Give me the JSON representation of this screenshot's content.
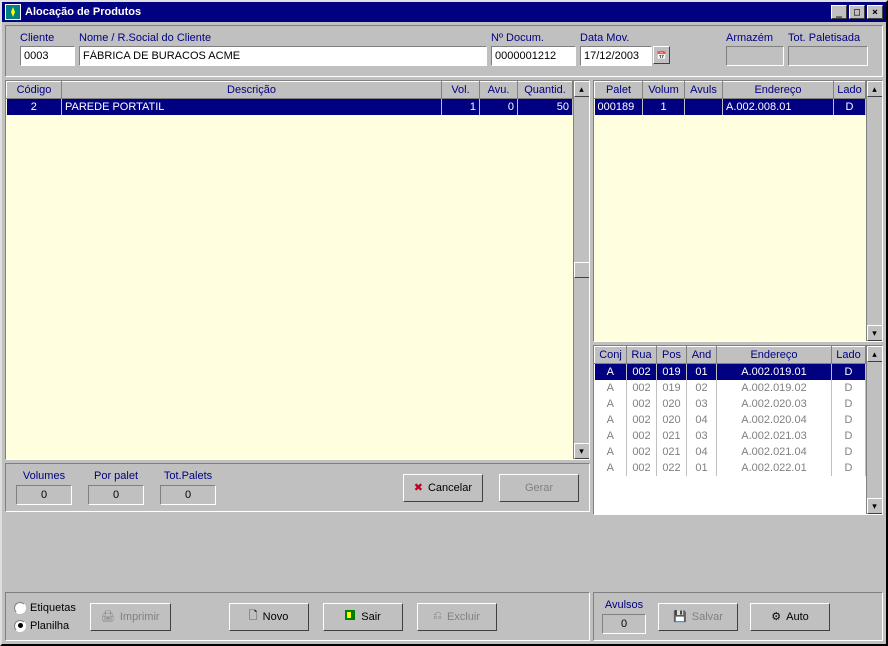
{
  "window": {
    "title": "Alocação de Produtos"
  },
  "header": {
    "labels": {
      "cliente": "Cliente",
      "nome": "Nome / R.Social do Cliente",
      "docum": "Nº Docum.",
      "datamov": "Data Mov.",
      "armazem": "Armazém",
      "totpal": "Tot. Paletisada"
    },
    "values": {
      "cliente": "0003",
      "nome": "FÁBRICA DE BURACOS ACME",
      "docum": "0000001212",
      "datamov": "17/12/2003",
      "armazem": "",
      "totpal": ""
    }
  },
  "products": {
    "headers": {
      "codigo": "Código",
      "descricao": "Descrição",
      "vol": "Vol.",
      "avu": "Avu.",
      "quant": "Quantid."
    },
    "rows": [
      {
        "codigo": "2",
        "descricao": "PAREDE PORTATIL",
        "vol": "1",
        "avu": "0",
        "quant": "50"
      }
    ]
  },
  "palet": {
    "headers": {
      "palet": "Palet",
      "volum": "Volum",
      "avuls": "Avuls",
      "endereco": "Endereço",
      "lado": "Lado"
    },
    "rows": [
      {
        "palet": "000189",
        "volum": "1",
        "avuls": "",
        "endereco": "A.002.008.01",
        "lado": "D"
      }
    ]
  },
  "addr": {
    "headers": {
      "conj": "Conj",
      "rua": "Rua",
      "pos": "Pos",
      "and": "And",
      "endereco": "Endereço",
      "lado": "Lado"
    },
    "rows": [
      {
        "conj": "A",
        "rua": "002",
        "pos": "019",
        "and": "01",
        "endereco": "A.002.019.01",
        "lado": "D",
        "sel": true
      },
      {
        "conj": "A",
        "rua": "002",
        "pos": "019",
        "and": "02",
        "endereco": "A.002.019.02",
        "lado": "D"
      },
      {
        "conj": "A",
        "rua": "002",
        "pos": "020",
        "and": "03",
        "endereco": "A.002.020.03",
        "lado": "D"
      },
      {
        "conj": "A",
        "rua": "002",
        "pos": "020",
        "and": "04",
        "endereco": "A.002.020.04",
        "lado": "D"
      },
      {
        "conj": "A",
        "rua": "002",
        "pos": "021",
        "and": "03",
        "endereco": "A.002.021.03",
        "lado": "D"
      },
      {
        "conj": "A",
        "rua": "002",
        "pos": "021",
        "and": "04",
        "endereco": "A.002.021.04",
        "lado": "D"
      },
      {
        "conj": "A",
        "rua": "002",
        "pos": "022",
        "and": "01",
        "endereco": "A.002.022.01",
        "lado": "D"
      }
    ]
  },
  "vol": {
    "labels": {
      "volumes": "Volumes",
      "porpalet": "Por palet",
      "totpalets": "Tot.Palets"
    },
    "values": {
      "volumes": "0",
      "porpalet": "0",
      "totpalets": "0"
    }
  },
  "buttons": {
    "cancelar": "Cancelar",
    "gerar": "Gerar",
    "imprimir": "Imprimir",
    "novo": "Novo",
    "sair": "Sair",
    "excluir": "Excluir",
    "salvar": "Salvar",
    "auto": "Auto"
  },
  "radios": {
    "etiquetas": "Etiquetas",
    "planilha": "Planilha"
  },
  "avulsos": {
    "label": "Avulsos",
    "value": "0"
  }
}
